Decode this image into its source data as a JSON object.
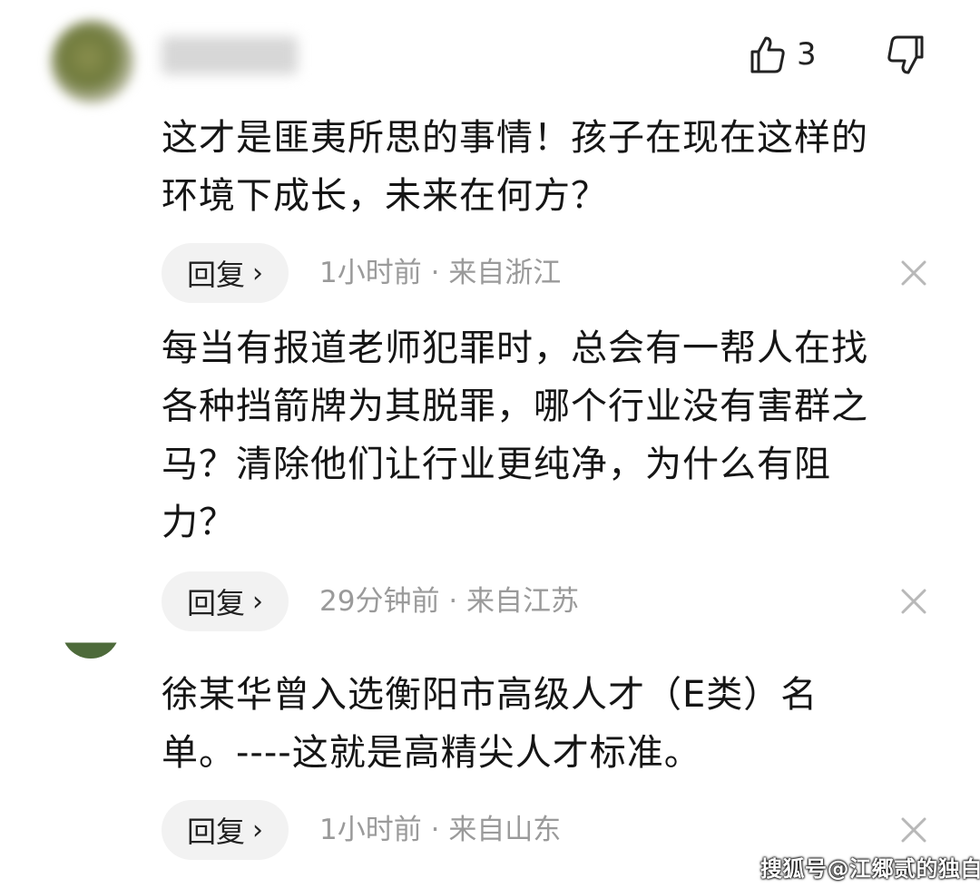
{
  "comments": [
    {
      "text_lines": [
        "这才是匪夷所思的事情！孩子在现在这样的",
        "环境下成长，未来在何方？"
      ],
      "reply_label": "回复",
      "time": "1小时前",
      "separator": "·",
      "location": "来自浙江",
      "like_count": "3"
    },
    {
      "text_lines": [
        "每当有报道老师犯罪时，总会有一帮人在找",
        "各种挡箭牌为其脱罪，哪个行业没有害群之",
        "马？清除他们让行业更纯净，为什么有阻",
        "力？"
      ],
      "reply_label": "回复",
      "time": "29分钟前",
      "separator": "·",
      "location": "来自江苏"
    },
    {
      "text_lines": [
        "徐某华曾入选衡阳市高级人才（E类）名",
        "单。----这就是高精尖人才标准。"
      ],
      "reply_label": "回复",
      "time": "1小时前",
      "separator": "·",
      "location": "来自山东"
    }
  ],
  "watermark": "搜狐号@江郷贰的独白",
  "icons": {
    "like": "thumbs-up-icon",
    "dislike": "thumbs-down-icon",
    "close": "close-icon",
    "chevron": "chevron-right-icon"
  },
  "colors": {
    "text": "#151515",
    "meta": "#9a9a9a",
    "reply_bg": "#f2f2f2"
  }
}
